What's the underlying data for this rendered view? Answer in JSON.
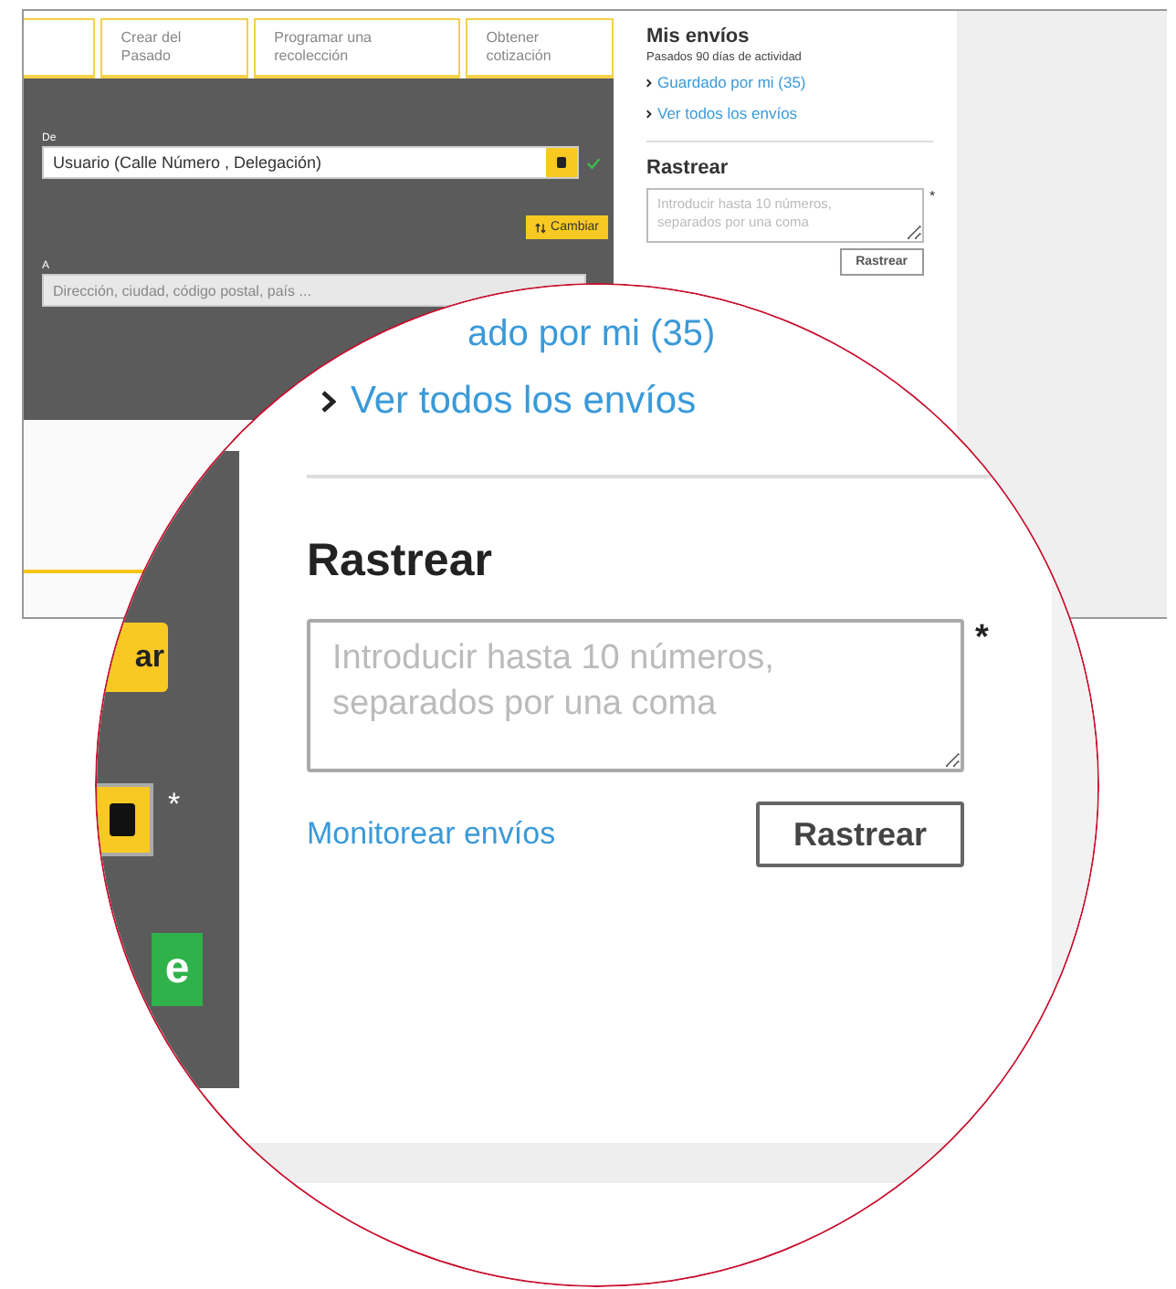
{
  "screenshot": {
    "tabs": [
      {
        "label": "Crear del Pasado"
      },
      {
        "label": "Programar una recolección"
      },
      {
        "label": "Obtener cotización"
      }
    ],
    "from": {
      "label": "De",
      "value": "Usuario (Calle Número , Delegación)",
      "valid": true
    },
    "swap_button": "Cambiar",
    "to": {
      "label": "A",
      "placeholder": "Dirección, ciudad, código postal, país ..."
    },
    "shipments": {
      "title": "Mis envíos",
      "subtitle": "Pasados 90 días de actividad",
      "links": [
        "Guardado por mi (35)",
        "Ver todos los envíos"
      ]
    },
    "track": {
      "title": "Rastrear",
      "placeholder": "Introducir hasta 10 números, separados por una coma",
      "required_mark": "*",
      "button": "Rastrear"
    }
  },
  "magnifier": {
    "partial_link": "ado por mi (35)",
    "link": "Ver todos los envíos",
    "track": {
      "title": "Rastrear",
      "placeholder": "Introducir hasta 10 números, separados por una coma",
      "required_mark": "*",
      "monitor_link": "Monitorear envíos",
      "button": "Rastrear"
    },
    "left": {
      "swap_button": "ar",
      "contact_required_mark": "*",
      "green_button": "e"
    }
  }
}
